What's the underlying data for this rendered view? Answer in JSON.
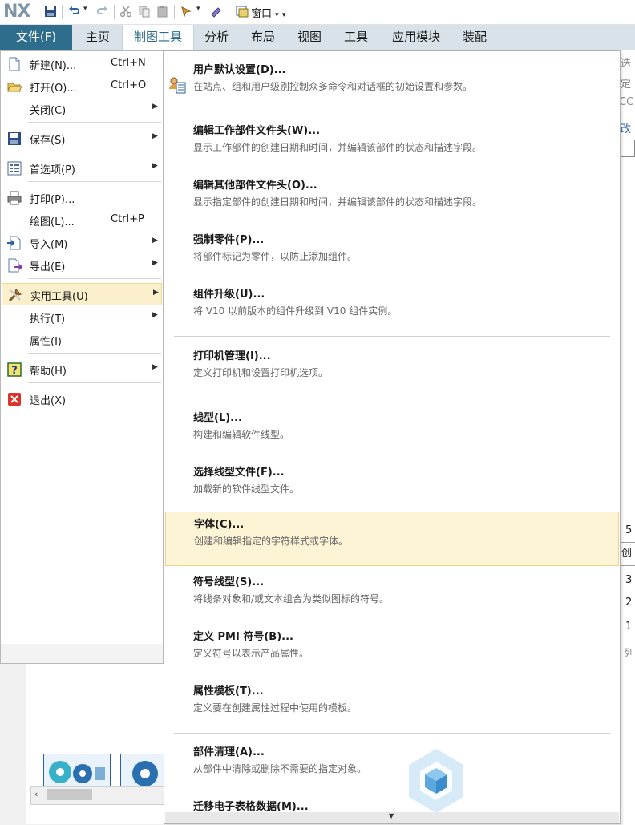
{
  "app": {
    "logo": "NX",
    "window_menu": "窗口"
  },
  "ribbon": {
    "tabs": [
      "文件(F)",
      "主页",
      "制图工具",
      "分析",
      "布局",
      "视图",
      "工具",
      "应用模块",
      "装配"
    ],
    "active_tab": "制图工具"
  },
  "file_menu": {
    "items": [
      {
        "label": "新建(N)...",
        "shortcut": "Ctrl+N",
        "icon": "new-file-icon"
      },
      {
        "label": "打开(O)...",
        "shortcut": "Ctrl+O",
        "icon": "open-folder-icon"
      },
      {
        "label": "关闭(C)",
        "has_submenu": true
      },
      {
        "label": "保存(S)",
        "has_submenu": true,
        "icon": "save-icon"
      },
      {
        "label": "首选项(P)",
        "has_submenu": true,
        "icon": "preferences-icon"
      },
      {
        "label": "打印(P)...",
        "icon": "printer-icon"
      },
      {
        "label": "绘图(L)...",
        "shortcut": "Ctrl+P"
      },
      {
        "label": "导入(M)",
        "has_submenu": true,
        "icon": "import-icon"
      },
      {
        "label": "导出(E)",
        "has_submenu": true,
        "icon": "export-icon"
      },
      {
        "label": "实用工具(U)",
        "has_submenu": true,
        "icon": "utilities-icon",
        "highlighted": true
      },
      {
        "label": "执行(T)",
        "has_submenu": true
      },
      {
        "label": "属性(I)"
      },
      {
        "label": "帮助(H)",
        "has_submenu": true,
        "icon": "help-icon"
      },
      {
        "label": "退出(X)",
        "icon": "exit-icon"
      }
    ]
  },
  "utilities_submenu": {
    "items": [
      {
        "title": "用户默认设置(D)...",
        "desc": "在站点、组和用户级别控制众多命令和对话框的初始设置和参数。",
        "icon": "user-defaults-icon"
      },
      {
        "title": "编辑工作部件文件头(W)...",
        "desc": "显示工作部件的创建日期和时间，并编辑该部件的状态和描述字段。"
      },
      {
        "title": "编辑其他部件文件头(O)...",
        "desc": "显示指定部件的创建日期和时间，并编辑该部件的状态和描述字段。"
      },
      {
        "title": "强制零件(P)...",
        "desc": "将部件标记为零件，以防止添加组件。"
      },
      {
        "title": "组件升级(U)...",
        "desc": "将 V10 以前版本的组件升级到 V10 组件实例。"
      },
      {
        "title": "打印机管理(I)...",
        "desc": "定义打印机和设置打印机选项。"
      },
      {
        "title": "线型(L)...",
        "desc": "构建和编辑软件线型。"
      },
      {
        "title": "选择线型文件(F)...",
        "desc": "加载新的软件线型文件。"
      },
      {
        "title": "字体(C)...",
        "desc": "创建和编辑指定的字符样式或字体。",
        "highlighted": true
      },
      {
        "title": "符号线型(S)...",
        "desc": "将线条对象和/或文本组合为类似图标的符号。"
      },
      {
        "title": "定义 PMI 符号(B)...",
        "desc": "定义符号以表示产品属性。"
      },
      {
        "title": "属性模板(T)...",
        "desc": "定义要在创建属性过程中使用的模板。"
      },
      {
        "title": "部件清理(A)...",
        "desc": "从部件中清除或删除不需要的指定对象。"
      },
      {
        "title": "迁移电子表格数据(M)...",
        "desc": ""
      }
    ]
  },
  "tooltip_fragment": "创",
  "background_fragments": [
    "迭",
    "定",
    "CC",
    "改",
    "5",
    "3",
    "2",
    "1",
    "列"
  ],
  "colors": {
    "accent": "#2e6e8c",
    "highlight": "#fdf4d6"
  }
}
